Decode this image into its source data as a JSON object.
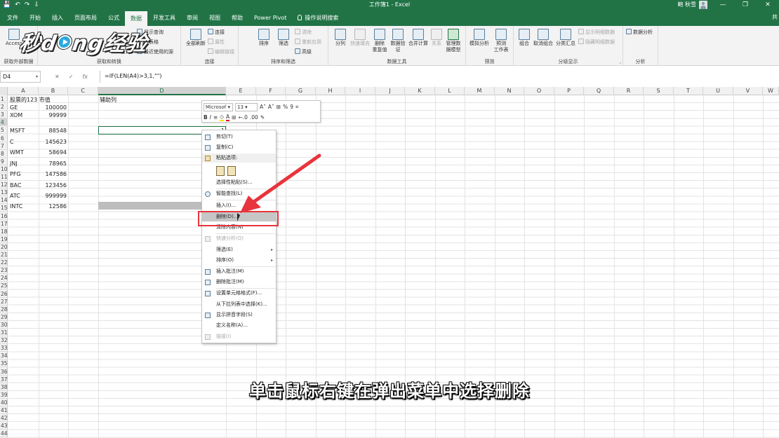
{
  "window": {
    "title": "工作簿1 - Excel",
    "user": "鲍 秋雪",
    "qat": [
      "💾",
      "↶",
      "↷",
      "⇩"
    ],
    "controls": [
      "—",
      "❐",
      "✕"
    ]
  },
  "tabs": [
    "文件",
    "开始",
    "插入",
    "页面布局",
    "公式",
    "数据",
    "开发工具",
    "审阅",
    "视图",
    "帮助",
    "Power Pivot",
    "操作说明搜索"
  ],
  "share_label": "共",
  "ribbon": {
    "get_external": {
      "access": "Access",
      "label": "获取外部数据"
    },
    "get_transform": {
      "show_query": "显示查询",
      "from_table": "从表格",
      "recent_sources": "最近使用的源",
      "query": "查询",
      "label": "获取和转换"
    },
    "connections": {
      "refresh_all": "全部刷新",
      "connections": "连接",
      "properties": "属性",
      "edit_links": "编辑链接",
      "label": "连接"
    },
    "sort_filter": {
      "sort": "排序",
      "filter": "筛选",
      "clear": "清除",
      "reapply": "重新应用",
      "advanced": "高级",
      "label": "排序和筛选"
    },
    "data_tools": {
      "text_to_columns": "分列",
      "flash_fill": "快速填充",
      "remove_dup": "删除\n重复值",
      "validation": "数据验\n证",
      "consolidate": "合并计算",
      "relationships": "关系",
      "manage_model": "管理数\n据模型",
      "label": "数据工具"
    },
    "forecast": {
      "what_if": "模拟分析",
      "forecast_sheet": "预测\n工作表",
      "label": "预测"
    },
    "outline": {
      "group": "组合",
      "ungroup": "取消组合",
      "subtotal": "分类汇总",
      "show_detail": "显示明细数据",
      "hide_detail": "隐藏明细数据",
      "label": "分级显示"
    },
    "analysis": {
      "data_analysis": "数据分析",
      "label": "分析"
    }
  },
  "watermark": {
    "a": "秒",
    "b": "d",
    "c": "ng",
    "d": "经验"
  },
  "formula_bar": {
    "name_box": "D4",
    "cancel": "✕",
    "enter": "✓",
    "fx": "fx",
    "formula": "=IF(LEN(A4)>3,1,\"\")"
  },
  "columns": [
    "A",
    "B",
    "C",
    "D",
    "E",
    "F",
    "G",
    "H",
    "I",
    "J",
    "K",
    "L",
    "M",
    "N",
    "O",
    "P",
    "Q",
    "R",
    "S",
    "T",
    "U",
    "V",
    "W"
  ],
  "rows": [
    "1",
    "2",
    "3",
    "4",
    "5",
    "6",
    "7",
    "8",
    "9",
    "10",
    "11",
    "12",
    "13",
    "14",
    "15",
    "16",
    "17",
    "18",
    "19",
    "20",
    "21",
    "22",
    "23",
    "24",
    "25",
    "26",
    "27",
    "28",
    "29",
    "30",
    "31",
    "32",
    "33",
    "34",
    "35",
    "36",
    "37",
    "38",
    "39",
    "40",
    "41",
    "42",
    "43",
    "44"
  ],
  "sheet": {
    "a1": "股票的123 市值",
    "d1": "辅助列",
    "e4": "1",
    "names": [
      "GE",
      "XOM",
      "MSFT",
      "C",
      "WMT",
      "JNJ",
      "PFG",
      "BAC",
      "ATC",
      "INTC"
    ],
    "values": [
      "100000",
      "99999",
      "88548",
      "145623",
      "58694",
      "78965",
      "147586",
      "123456",
      "999999",
      "12586"
    ]
  },
  "mini_toolbar": {
    "font": "Microsof",
    "size": "13",
    "grow": "A˄",
    "shrink": "A˅",
    "currency": "⊞",
    "percent": "%",
    "comma": "9",
    "format_painter": "⌗",
    "bold": "B",
    "italic": "I",
    "align": "≡",
    "fill": "◇",
    "font_color": "A",
    "borders": "⊞",
    "inc_dec": "←.0",
    "dec_dec": ".00",
    "brush": "✎"
  },
  "context_menu": {
    "cut": "剪切(T)",
    "copy": "复制(C)",
    "paste_options": "粘贴选项:",
    "paste_special": "选择性粘贴(S)...",
    "smart_lookup": "智能查找(L)",
    "insert": "插入(I)...",
    "delete": "删除(D)...",
    "clear": "清除内容(N)",
    "quick_analysis": "快速分析(Q)",
    "filter": "筛选(E)",
    "sort": "排序(O)",
    "insert_comment": "插入批注(M)",
    "delete_comment": "删除批注(M)",
    "format_cells": "设置单元格格式(F)...",
    "pick_list": "从下拉列表中选择(K)...",
    "phonetic": "显示拼音字段(S)",
    "define_name": "定义名称(A)...",
    "link": "链接(I)",
    "submenu_arrow": "▸"
  },
  "caption": "单击鼠标右键在弹出菜单中选择删除",
  "colors": {
    "accent": "#217346",
    "highlight_box": "#e8343c"
  }
}
